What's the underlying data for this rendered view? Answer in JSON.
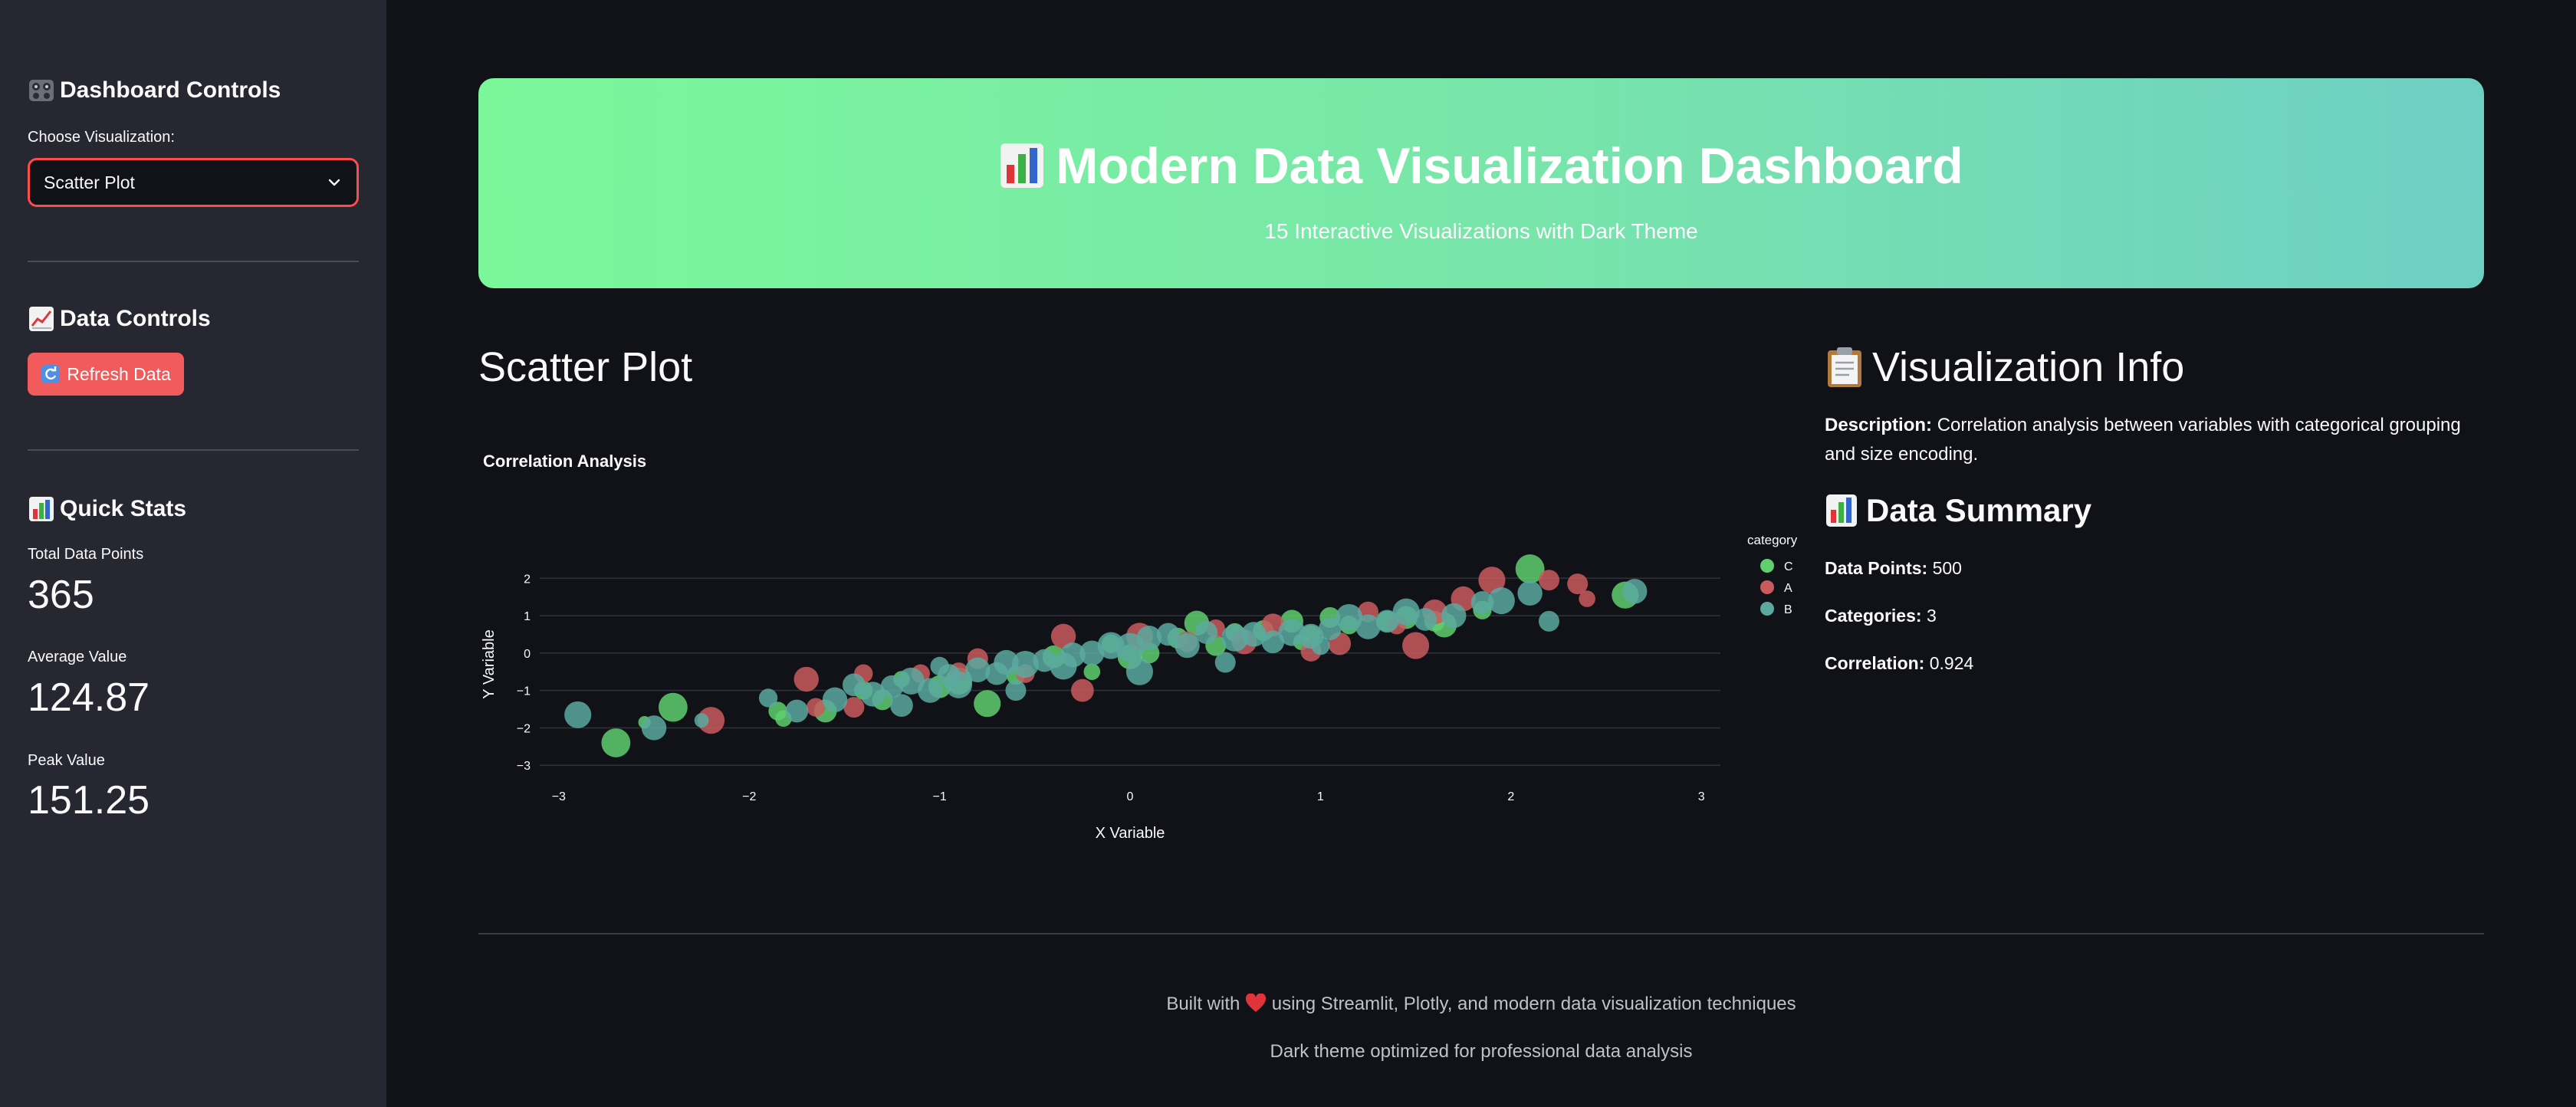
{
  "sidebar": {
    "controls_heading": "Dashboard Controls",
    "choose_label": "Choose Visualization:",
    "selected_visualization": "Scatter Plot",
    "data_controls_heading": "Data Controls",
    "refresh_label": "Refresh Data",
    "quick_stats_heading": "Quick Stats",
    "stats": [
      {
        "label": "Total Data Points",
        "value": "365"
      },
      {
        "label": "Average Value",
        "value": "124.87"
      },
      {
        "label": "Peak Value",
        "value": "151.25"
      }
    ]
  },
  "header": {
    "title": "Modern Data Visualization Dashboard",
    "subtitle": "15 Interactive Visualizations with Dark Theme"
  },
  "main": {
    "section_title": "Scatter Plot"
  },
  "info": {
    "heading": "Visualization Info",
    "description_label": "Description:",
    "description": "Correlation analysis between variables with categorical grouping and size encoding.",
    "summary_heading": "Data Summary",
    "data_points_label": "Data Points:",
    "data_points": "500",
    "categories_label": "Categories:",
    "categories": "3",
    "correlation_label": "Correlation:",
    "correlation": "0.924"
  },
  "footer": {
    "line1_before": "Built with",
    "line1_after": "using Streamlit, Plotly, and modern data visualization techniques",
    "line2": "Dark theme optimized for professional data analysis"
  },
  "colors": {
    "accent": "#ff4b4b",
    "button": "#f15b5b",
    "series_C": "#5fcf6f",
    "series_A": "#c95a5e",
    "series_B": "#5aa9a0"
  },
  "icons": {
    "controls": "control-knobs-icon",
    "data_controls": "chart-increasing-icon",
    "quick_stats": "bar-chart-icon",
    "refresh": "refresh-icon",
    "info": "clipboard-icon",
    "heart": "heart-icon"
  },
  "chart_data": {
    "type": "scatter",
    "title": "Correlation Analysis",
    "xlabel": "X Variable",
    "ylabel": "Y Variable",
    "xlim": [
      -3.1,
      3.1
    ],
    "ylim": [
      -3.2,
      2.6
    ],
    "x_ticks": [
      -3,
      -2,
      -1,
      0,
      1,
      2,
      3
    ],
    "y_ticks": [
      -3,
      -2,
      -1,
      0,
      1,
      2
    ],
    "grid": "y",
    "legend_title": "category",
    "legend_placement": "top-right",
    "series": [
      {
        "name": "C",
        "color": "#5fcf6f",
        "points": [
          [
            -2.7,
            -2.4,
            14
          ],
          [
            -2.55,
            -1.85,
            6
          ],
          [
            -2.4,
            -1.45,
            14
          ],
          [
            -1.85,
            -1.55,
            9
          ],
          [
            -1.82,
            -1.75,
            8
          ],
          [
            -1.6,
            -1.55,
            11
          ],
          [
            -1.4,
            -1.0,
            9
          ],
          [
            -1.3,
            -1.25,
            10
          ],
          [
            -1.2,
            -0.7,
            8
          ],
          [
            -1.0,
            -0.9,
            11
          ],
          [
            -0.9,
            -0.75,
            13
          ],
          [
            -0.75,
            -1.35,
            13
          ],
          [
            -0.6,
            -0.6,
            9
          ],
          [
            -0.4,
            -0.1,
            11
          ],
          [
            -0.2,
            -0.5,
            8
          ],
          [
            0.0,
            -0.1,
            12
          ],
          [
            0.1,
            0.0,
            10
          ],
          [
            0.25,
            0.4,
            10
          ],
          [
            0.35,
            0.8,
            12
          ],
          [
            0.55,
            0.55,
            9
          ],
          [
            0.7,
            0.6,
            10
          ],
          [
            0.85,
            0.85,
            11
          ],
          [
            0.95,
            0.5,
            9
          ],
          [
            1.05,
            0.95,
            10
          ],
          [
            1.15,
            0.75,
            9
          ],
          [
            1.35,
            0.85,
            10
          ],
          [
            1.45,
            0.95,
            11
          ],
          [
            1.6,
            0.85,
            10
          ],
          [
            1.65,
            0.75,
            12
          ],
          [
            1.85,
            1.15,
            9
          ],
          [
            2.1,
            2.25,
            14
          ],
          [
            2.6,
            1.55,
            13
          ],
          [
            0.9,
            0.3,
            8
          ],
          [
            -0.1,
            0.25,
            9
          ],
          [
            0.45,
            0.2,
            10
          ]
        ]
      },
      {
        "name": "A",
        "color": "#c95a5e",
        "points": [
          [
            -2.2,
            -1.8,
            13
          ],
          [
            -1.7,
            -0.7,
            12
          ],
          [
            -1.65,
            -1.45,
            9
          ],
          [
            -1.45,
            -1.45,
            10
          ],
          [
            -1.4,
            -0.55,
            9
          ],
          [
            -1.1,
            -0.55,
            9
          ],
          [
            -0.8,
            -0.15,
            10
          ],
          [
            -0.55,
            -0.55,
            9
          ],
          [
            -0.35,
            0.45,
            12
          ],
          [
            -0.25,
            -1.0,
            11
          ],
          [
            0.05,
            0.45,
            13
          ],
          [
            0.3,
            0.3,
            10
          ],
          [
            0.6,
            0.3,
            12
          ],
          [
            0.75,
            0.75,
            11
          ],
          [
            0.95,
            0.05,
            10
          ],
          [
            1.1,
            0.25,
            11
          ],
          [
            1.25,
            1.1,
            10
          ],
          [
            1.4,
            0.75,
            9
          ],
          [
            1.5,
            0.2,
            13
          ],
          [
            1.6,
            1.1,
            12
          ],
          [
            1.75,
            1.45,
            12
          ],
          [
            1.9,
            1.95,
            13
          ],
          [
            2.2,
            1.95,
            10
          ],
          [
            2.35,
            1.85,
            10
          ],
          [
            2.4,
            1.45,
            8
          ],
          [
            0.45,
            0.65,
            9
          ],
          [
            -0.9,
            -0.5,
            9
          ]
        ]
      },
      {
        "name": "B",
        "color": "#5aa9a0",
        "points": [
          [
            -2.9,
            -1.65,
            13
          ],
          [
            -2.5,
            -2.0,
            12
          ],
          [
            -2.25,
            -1.8,
            7
          ],
          [
            -1.75,
            -1.55,
            11
          ],
          [
            -1.55,
            -1.25,
            12
          ],
          [
            -1.45,
            -0.85,
            11
          ],
          [
            -1.35,
            -1.1,
            12
          ],
          [
            -1.25,
            -0.9,
            11
          ],
          [
            -1.15,
            -0.75,
            13
          ],
          [
            -1.05,
            -1.0,
            12
          ],
          [
            -0.95,
            -0.6,
            11
          ],
          [
            -0.9,
            -0.85,
            13
          ],
          [
            -0.8,
            -0.45,
            12
          ],
          [
            -0.7,
            -0.55,
            11
          ],
          [
            -0.65,
            -0.25,
            12
          ],
          [
            -0.55,
            -0.3,
            13
          ],
          [
            -0.45,
            -0.2,
            11
          ],
          [
            -0.35,
            -0.35,
            13
          ],
          [
            -0.3,
            -0.05,
            12
          ],
          [
            -0.2,
            0.0,
            12
          ],
          [
            -0.1,
            0.2,
            13
          ],
          [
            0.0,
            0.15,
            14
          ],
          [
            0.1,
            0.4,
            12
          ],
          [
            0.2,
            0.5,
            11
          ],
          [
            0.3,
            0.2,
            12
          ],
          [
            0.4,
            0.55,
            11
          ],
          [
            0.55,
            0.4,
            13
          ],
          [
            0.65,
            0.5,
            12
          ],
          [
            0.75,
            0.3,
            11
          ],
          [
            0.85,
            0.55,
            13
          ],
          [
            0.95,
            0.45,
            12
          ],
          [
            1.05,
            0.65,
            11
          ],
          [
            1.15,
            0.95,
            13
          ],
          [
            1.25,
            0.7,
            12
          ],
          [
            1.35,
            0.85,
            11
          ],
          [
            1.45,
            1.1,
            13
          ],
          [
            1.55,
            0.9,
            11
          ],
          [
            1.7,
            1.0,
            12
          ],
          [
            1.85,
            1.35,
            11
          ],
          [
            1.95,
            1.4,
            13
          ],
          [
            2.1,
            1.6,
            12
          ],
          [
            2.2,
            0.85,
            10
          ],
          [
            2.65,
            1.65,
            12
          ],
          [
            -0.6,
            -1.0,
            10
          ],
          [
            0.05,
            -0.5,
            13
          ],
          [
            0.5,
            -0.25,
            10
          ],
          [
            -1.0,
            -0.35,
            9
          ],
          [
            1.0,
            0.2,
            9
          ],
          [
            -1.9,
            -1.2,
            9
          ],
          [
            -1.2,
            -1.4,
            11
          ]
        ]
      }
    ]
  }
}
